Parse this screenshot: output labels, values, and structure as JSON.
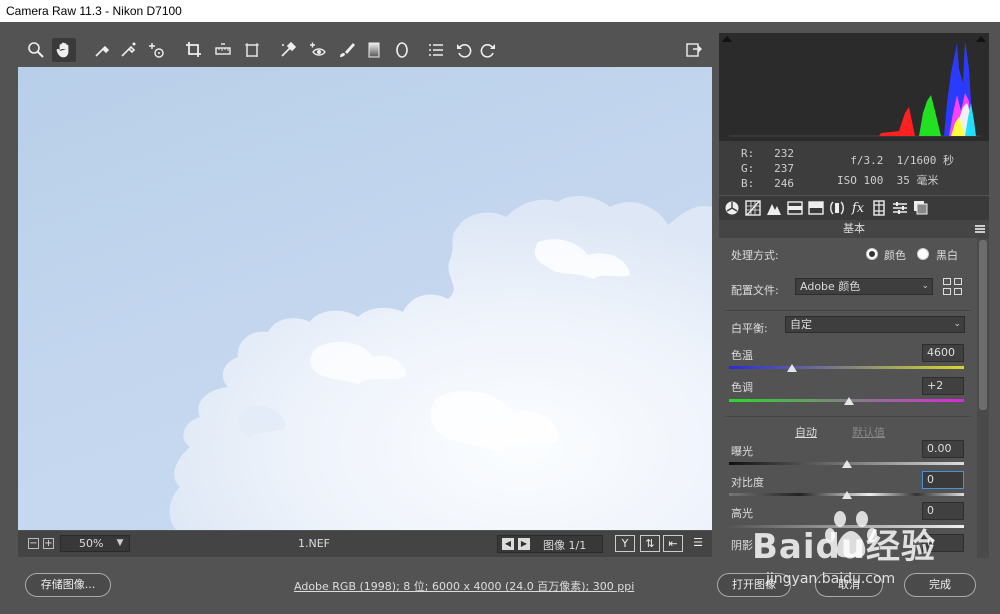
{
  "window": {
    "title": "Camera Raw 11.3 -  Nikon D7100"
  },
  "toolbar": {
    "tools": [
      {
        "icon": "zoom-icon"
      },
      {
        "icon": "hand-icon",
        "active": true
      },
      {
        "icon": "white-balance-icon"
      },
      {
        "icon": "color-sampler-icon"
      },
      {
        "icon": "targeted-adjustment-icon"
      },
      {
        "icon": "crop-icon"
      },
      {
        "icon": "straighten-icon"
      },
      {
        "icon": "transform-icon"
      },
      {
        "icon": "spot-removal-icon"
      },
      {
        "icon": "red-eye-icon"
      },
      {
        "icon": "adjustment-brush-icon"
      },
      {
        "icon": "graduated-filter-icon"
      },
      {
        "icon": "radial-filter-icon"
      },
      {
        "icon": "preferences-icon"
      },
      {
        "icon": "rotate-ccw-icon"
      },
      {
        "icon": "rotate-cw-icon"
      },
      {
        "icon": "fullscreen-icon"
      }
    ]
  },
  "statusbar": {
    "zoom_out": "−",
    "zoom_in": "+",
    "zoom_value": "50%",
    "filename": "1.NEF",
    "image_counter": "图像 1/1",
    "before_after_label": "Y"
  },
  "info": {
    "r_label": "R:",
    "r_value": "232",
    "g_label": "G:",
    "g_value": "237",
    "b_label": "B:",
    "b_value": "246",
    "aperture": "f/3.2",
    "shutter": "1/1600 秒",
    "iso": "ISO 100",
    "focal_length": "35 毫米"
  },
  "panel": {
    "section_title": "基本",
    "treatment_label": "处理方式:",
    "treatment_color": "颜色",
    "treatment_bw": "黑白",
    "treatment_selected": "color",
    "profile_label": "配置文件:",
    "profile_value": "Adobe 颜色",
    "wb_label": "白平衡:",
    "wb_value": "自定",
    "temp_label": "色温",
    "temp_value": "4600",
    "temp_position": 0.27,
    "tint_label": "色调",
    "tint_value": "+2",
    "tint_position": 0.51,
    "auto_label": "自动",
    "default_label": "默认值",
    "exposure_label": "曝光",
    "exposure_value": "0.00",
    "exposure_position": 0.5,
    "contrast_label": "对比度",
    "contrast_value": "0",
    "contrast_position": 0.5,
    "highlights_label": "高光",
    "highlights_value": "0",
    "shadows_label": "阴影",
    "shadows_value": "0"
  },
  "footer": {
    "save_button": "存储图像...",
    "workflow_info": "Adobe RGB (1998); 8 位; 6000 x 4000 (24.0 百万像素); 300 ppi",
    "open_button": "打开图像",
    "cancel_button": "取消",
    "done_button": "完成"
  },
  "watermark": {
    "title": "Baidu经验",
    "subtitle": "jingyan.baidu.com"
  },
  "colors": {
    "panel_bg": "#535353",
    "histogram_bg": "#2b2b2b",
    "sky": "#c3d6ee",
    "focus_blue": "#4d8fd8"
  }
}
